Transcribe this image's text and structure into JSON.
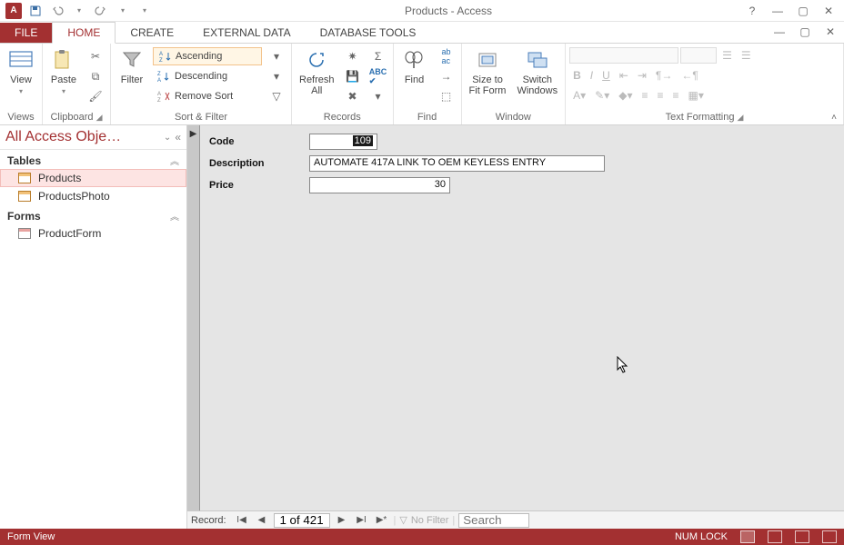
{
  "titlebar": {
    "title": "Products - Access"
  },
  "tabs": {
    "file": "FILE",
    "home": "HOME",
    "create": "CREATE",
    "external": "EXTERNAL DATA",
    "dbtools": "DATABASE TOOLS"
  },
  "ribbon": {
    "views": {
      "label": "Views",
      "view": "View"
    },
    "clipboard": {
      "label": "Clipboard",
      "paste": "Paste"
    },
    "sortfilter": {
      "label": "Sort & Filter",
      "filter": "Filter",
      "ascending": "Ascending",
      "descending": "Descending",
      "removesort": "Remove Sort"
    },
    "records": {
      "label": "Records",
      "refresh": "Refresh\nAll"
    },
    "find": {
      "label": "Find",
      "find": "Find"
    },
    "window": {
      "label": "Window",
      "sizetofit": "Size to\nFit Form",
      "switch": "Switch\nWindows"
    },
    "textformat": {
      "label": "Text Formatting"
    }
  },
  "navpane": {
    "header": "All Access Obje…",
    "sections": {
      "tables": "Tables",
      "forms": "Forms"
    },
    "items": {
      "products": "Products",
      "productsphoto": "ProductsPhoto",
      "productform": "ProductForm"
    }
  },
  "form": {
    "labels": {
      "code": "Code",
      "description": "Description",
      "price": "Price"
    },
    "values": {
      "code_selected": "109",
      "description": "AUTOMATE 417A LINK TO OEM KEYLESS ENTRY",
      "price": "30"
    }
  },
  "recordnav": {
    "label": "Record:",
    "position": "1 of 421",
    "nofilter": "No Filter",
    "search_placeholder": "Search"
  },
  "statusbar": {
    "left": "Form View",
    "numlock": "NUM LOCK"
  }
}
